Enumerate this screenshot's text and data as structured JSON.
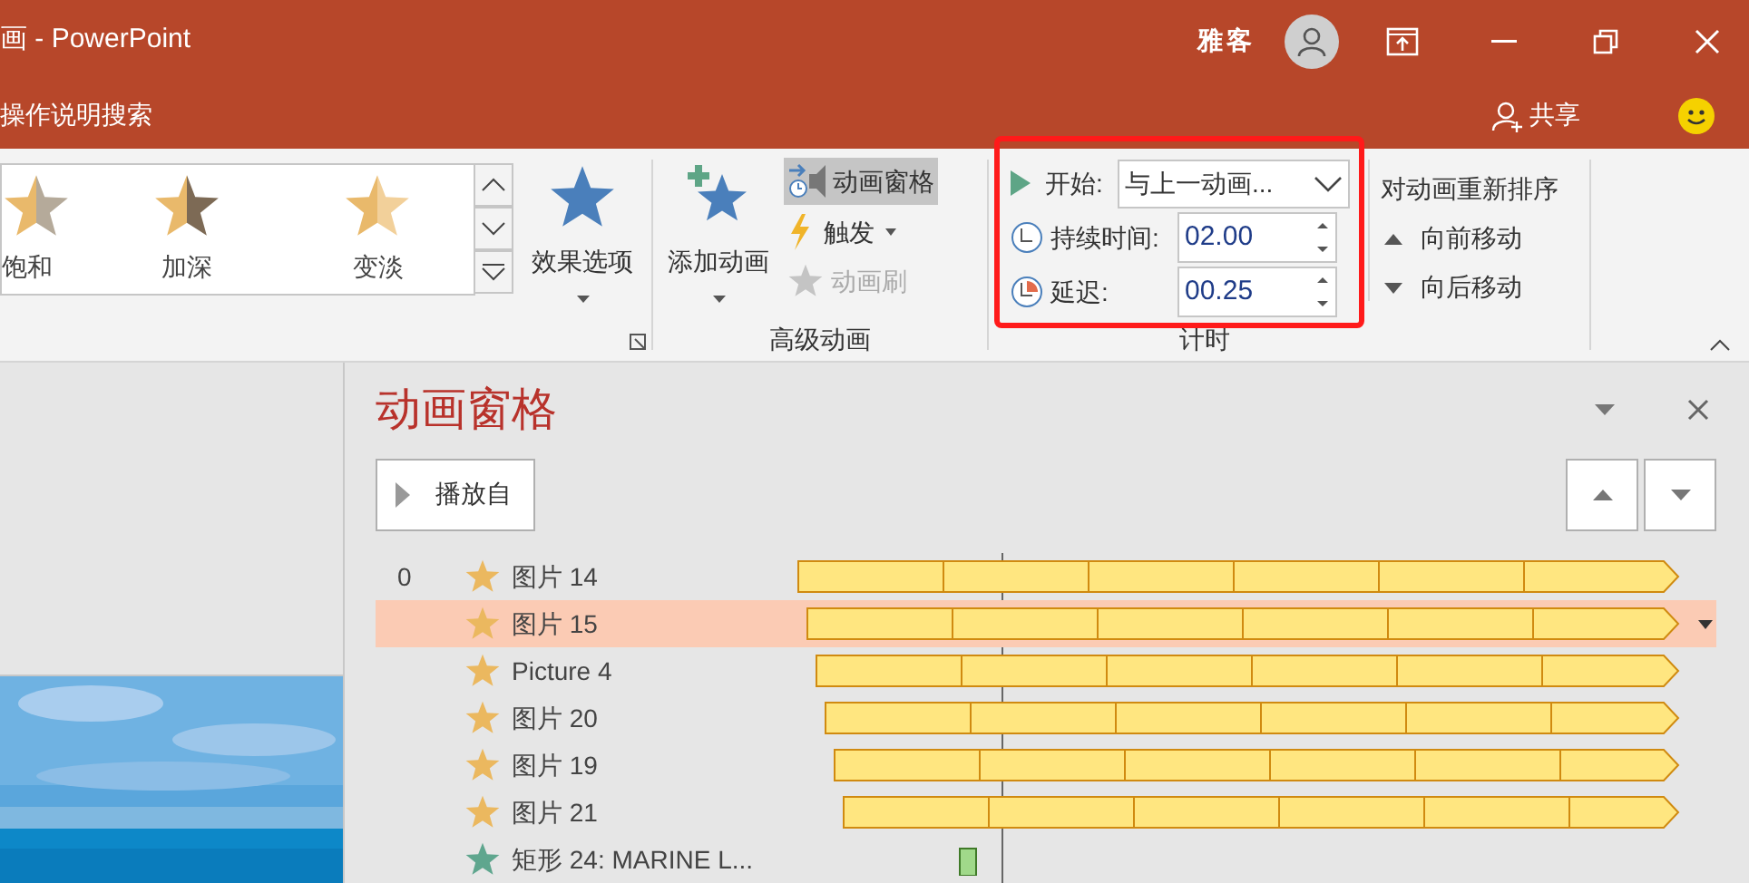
{
  "window": {
    "title": "画 - PowerPoint",
    "user": "雅客"
  },
  "search": {
    "placeholder": "操作说明搜索"
  },
  "share": "共享",
  "ribbon": {
    "gallery": [
      {
        "label": "饱和",
        "kind": "desaturate"
      },
      {
        "label": "加深",
        "kind": "darken"
      },
      {
        "label": "变淡",
        "kind": "lighten"
      }
    ],
    "effect_options": "效果选项",
    "advanced": {
      "add_animation": "添加动画",
      "pane_button": {
        "label": "动画窗格",
        "selected": true
      },
      "trigger": "触发",
      "painter": {
        "label": "动画刷",
        "disabled": true
      },
      "group_label": "高级动画"
    },
    "timing": {
      "start_label": "开始:",
      "start_value": "与上一动画...",
      "duration_label": "持续时间:",
      "duration": "02.00",
      "delay_label": "延迟:",
      "delay": "00.25",
      "group_label": "计时"
    },
    "reorder": {
      "title": "对动画重新排序",
      "forward": "向前移动",
      "backward": "向后移动"
    }
  },
  "pane": {
    "title": "动画窗格",
    "play_button": "播放自",
    "items": [
      {
        "index": "0",
        "name": "图片 14",
        "kind": "emphasis",
        "selected": false
      },
      {
        "name": "图片 15",
        "kind": "emphasis",
        "selected": true
      },
      {
        "name": "Picture 4",
        "kind": "emphasis",
        "selected": false
      },
      {
        "name": "图片 20",
        "kind": "emphasis",
        "selected": false
      },
      {
        "name": "图片 19",
        "kind": "emphasis",
        "selected": false
      },
      {
        "name": "图片 21",
        "kind": "emphasis",
        "selected": false
      },
      {
        "name": "矩形 24: MARINE L...",
        "kind": "entrance",
        "selected": false
      }
    ]
  }
}
